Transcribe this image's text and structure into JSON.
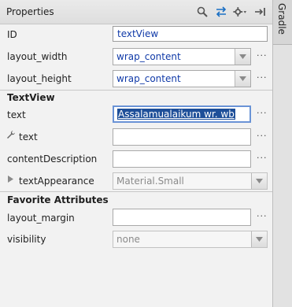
{
  "header": {
    "title": "Properties",
    "icons": [
      "search-icon",
      "swap-arrows-icon",
      "gear-icon",
      "pin-to-edge-icon"
    ]
  },
  "side_tab": {
    "label": "Gradle"
  },
  "rows": {
    "id": {
      "label": "ID",
      "value": "textView"
    },
    "layout_width": {
      "label": "layout_width",
      "value": "wrap_content"
    },
    "layout_height": {
      "label": "layout_height",
      "value": "wrap_content"
    }
  },
  "section_textview": "TextView",
  "textview": {
    "text": {
      "label": "text",
      "value": "Assalamualaikum wr. wb"
    },
    "tools_text": {
      "label": "text",
      "value": ""
    },
    "content_description": {
      "label": "contentDescription",
      "value": ""
    },
    "text_appearance": {
      "label": "textAppearance",
      "value": "Material.Small"
    }
  },
  "section_favorites": "Favorite Attributes",
  "favorites": {
    "layout_margin": {
      "label": "layout_margin",
      "value": ""
    },
    "visibility": {
      "label": "visibility",
      "value": "none"
    }
  },
  "ellipsis": "···",
  "colors": {
    "link_value": "#103aa8",
    "selection": "#1e4f99",
    "accent_icon": "#1a6fc4"
  }
}
